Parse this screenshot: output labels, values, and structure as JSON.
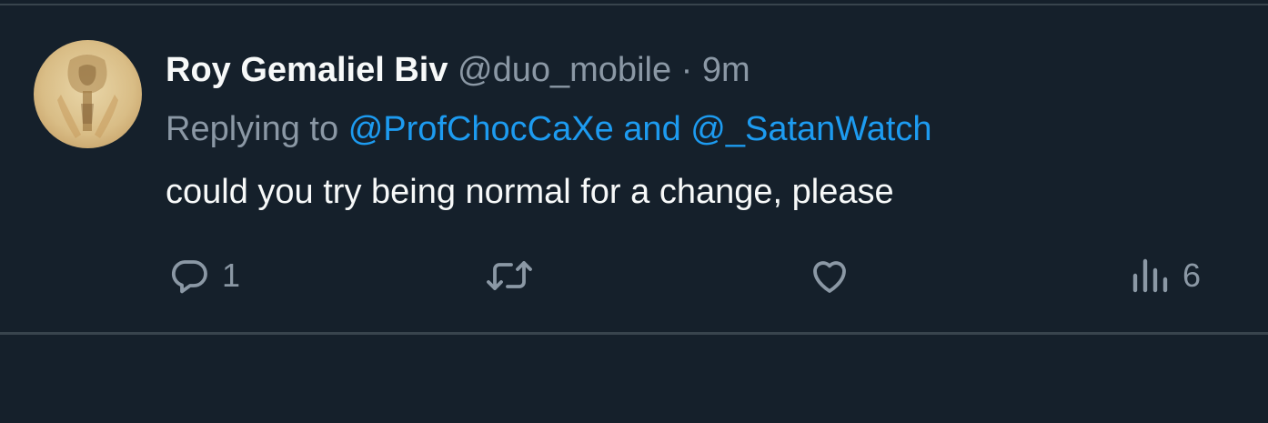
{
  "tweet": {
    "author_name": "Roy Gemaliel Biv",
    "handle": "@duo_mobile",
    "separator": "·",
    "time": "9m",
    "replying_prefix": "Replying to",
    "reply_mention_1": "@ProfChocCaXe",
    "reply_and": "and",
    "reply_mention_2": "@_SatanWatch",
    "text": "could you try being normal for a change, please"
  },
  "actions": {
    "reply": {
      "icon": "reply-icon",
      "count": "1"
    },
    "retweet": {
      "icon": "retweet-icon",
      "count": ""
    },
    "like": {
      "icon": "heart-icon",
      "count": ""
    },
    "views": {
      "icon": "views-icon",
      "count": "6"
    }
  },
  "colors": {
    "background": "#15202b",
    "primary_text": "#f7f9f9",
    "secondary_text": "#8b98a5",
    "link": "#1d9bf0",
    "border": "#38444d"
  }
}
